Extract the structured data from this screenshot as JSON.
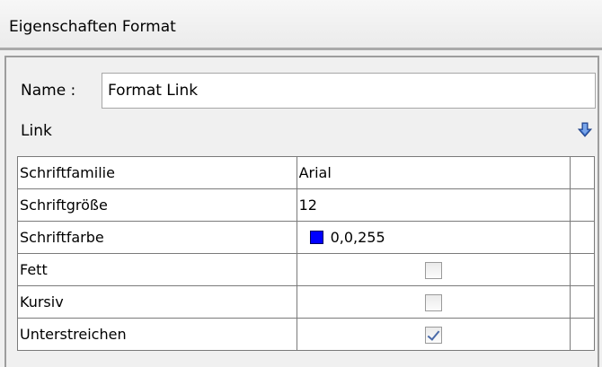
{
  "header": {
    "title": "Eigenschaften Format"
  },
  "name_field": {
    "label": "Name :",
    "value": "Format Link"
  },
  "section": {
    "label": "Link",
    "icon": "arrow-down-icon",
    "accent": "#2f5fb6"
  },
  "properties": [
    {
      "name": "Schriftfamilie",
      "value": "Arial",
      "type": "text"
    },
    {
      "name": "Schriftgröße",
      "value": "12",
      "type": "text"
    },
    {
      "name": "Schriftfarbe",
      "value": "0,0,255",
      "type": "color",
      "color": "#0000ff"
    },
    {
      "name": "Fett",
      "checked": false,
      "type": "checkbox"
    },
    {
      "name": "Kursiv",
      "checked": false,
      "type": "checkbox"
    },
    {
      "name": "Unterstreichen",
      "checked": true,
      "type": "checkbox"
    }
  ]
}
